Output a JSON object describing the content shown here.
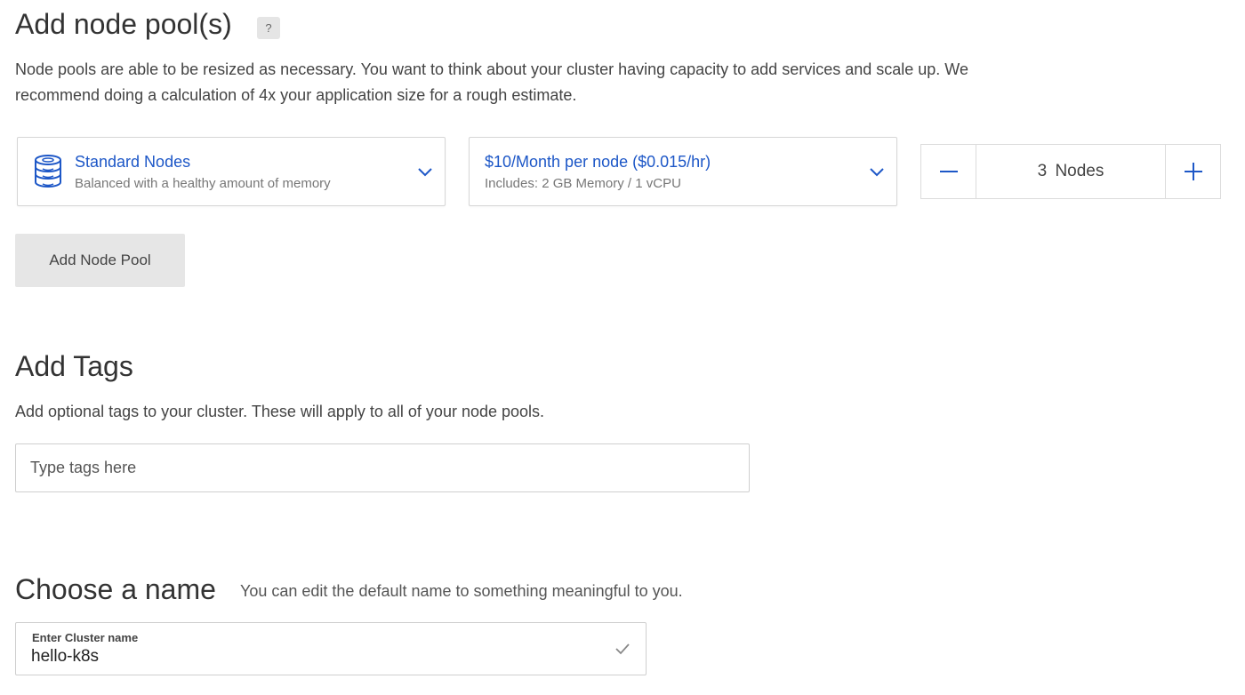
{
  "node_pools": {
    "title": "Add node pool(s)",
    "help_label": "?",
    "description": "Node pools are able to be resized as necessary. You want to think about your cluster having capacity to add services and scale up. We recommend doing a calculation of 4x your application size for a rough estimate.",
    "node_type": {
      "icon": "database-icon",
      "title": "Standard Nodes",
      "subtitle": "Balanced with a healthy amount of memory"
    },
    "node_plan": {
      "title": "$10/Month per node ($0.015/hr)",
      "subtitle": "Includes: 2 GB Memory / 1 vCPU"
    },
    "node_count": {
      "value": "3 Nodes",
      "count": 3
    },
    "add_button_label": "Add Node Pool"
  },
  "tags": {
    "title": "Add Tags",
    "description": "Add optional tags to your cluster. These will apply to all of your node pools.",
    "placeholder": "Type tags here",
    "value": ""
  },
  "name": {
    "title": "Choose a name",
    "hint": "You can edit the default name to something meaningful to you.",
    "field_label": "Enter Cluster name",
    "field_value": "hello-k8s"
  },
  "colors": {
    "link_blue": "#1d57c7",
    "text": "#333333",
    "border": "#d6d6d6",
    "button_bg": "#e6e6e6"
  }
}
